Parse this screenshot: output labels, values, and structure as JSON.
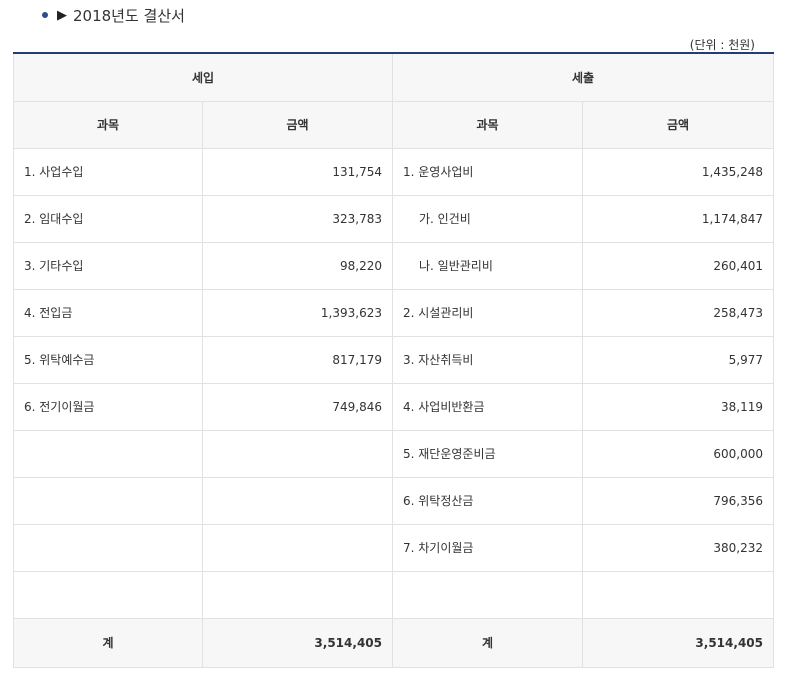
{
  "title": "2018년도 결산서",
  "unit": "(단위 : 천원)",
  "headers": {
    "income": "세입",
    "expense": "세출",
    "subject": "과목",
    "amount": "금액"
  },
  "rows": [
    {
      "in_subject": "1. 사업수입",
      "in_amount": "131,754",
      "out_subject": "1. 운영사업비",
      "out_amount": "1,435,248"
    },
    {
      "in_subject": "2. 임대수입",
      "in_amount": "323,783",
      "out_subject": "가. 인건비",
      "out_amount": "1,174,847"
    },
    {
      "in_subject": "3. 기타수입",
      "in_amount": "98,220",
      "out_subject": "나. 일반관리비",
      "out_amount": "260,401"
    },
    {
      "in_subject": "4. 전입금",
      "in_amount": "1,393,623",
      "out_subject": "2. 시설관리비",
      "out_amount": "258,473"
    },
    {
      "in_subject": "5. 위탁예수금",
      "in_amount": "817,179",
      "out_subject": "3. 자산취득비",
      "out_amount": "5,977"
    },
    {
      "in_subject": "6. 전기이월금",
      "in_amount": "749,846",
      "out_subject": "4. 사업비반환금",
      "out_amount": "38,119"
    },
    {
      "in_subject": "",
      "in_amount": "",
      "out_subject": "5. 재단운영준비금",
      "out_amount": "600,000"
    },
    {
      "in_subject": "",
      "in_amount": "",
      "out_subject": "6. 위탁정산금",
      "out_amount": "796,356"
    },
    {
      "in_subject": "",
      "in_amount": "",
      "out_subject": "7. 차기이월금",
      "out_amount": "380,232"
    },
    {
      "in_subject": "",
      "in_amount": "",
      "out_subject": "",
      "out_amount": ""
    }
  ],
  "total": {
    "in_label": "계",
    "in_amount": "3,514,405",
    "out_label": "계",
    "out_amount": "3,514,405"
  }
}
